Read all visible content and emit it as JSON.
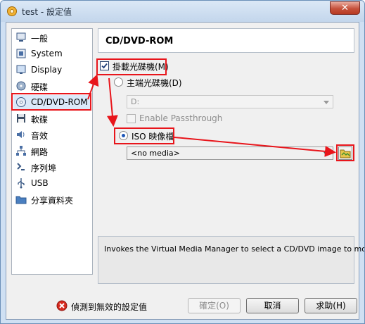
{
  "window": {
    "title": "test - 設定值",
    "close_label": "✕"
  },
  "sidebar": {
    "items": [
      {
        "label": "一般",
        "icon": "general-icon"
      },
      {
        "label": "System",
        "icon": "system-icon"
      },
      {
        "label": "Display",
        "icon": "display-icon"
      },
      {
        "label": "硬碟",
        "icon": "hard-disk-icon"
      },
      {
        "label": "CD/DVD-ROM",
        "icon": "cd-dvd-icon"
      },
      {
        "label": "軟碟",
        "icon": "floppy-icon"
      },
      {
        "label": "音效",
        "icon": "audio-icon"
      },
      {
        "label": "網路",
        "icon": "network-icon"
      },
      {
        "label": "序列埠",
        "icon": "serial-port-icon"
      },
      {
        "label": "USB",
        "icon": "usb-icon"
      },
      {
        "label": "分享資料夾",
        "icon": "shared-folder-icon"
      }
    ],
    "selected_index": 4
  },
  "main": {
    "page_title": "CD/DVD-ROM",
    "mount_checkbox_label": "掛載光碟機(M)",
    "mount_checked": true,
    "host_drive_label": "主端光碟機(D)",
    "host_drive_value": "D:",
    "passthrough_label": "Enable Passthrough",
    "iso_label": "ISO 映像檔",
    "iso_selected": true,
    "iso_value": "<no media>",
    "description": "Invokes the Virtual Media Manager to select a CD/DVD image to mount."
  },
  "footer": {
    "warning_text": "偵測到無效的設定值",
    "ok_label": "確定(O)",
    "cancel_label": "取消",
    "help_label": "求助(H)"
  },
  "colors": {
    "highlight": "#e8151b",
    "selected_bg": "#dbe9f9",
    "window_frame": "#cfe0f3"
  }
}
